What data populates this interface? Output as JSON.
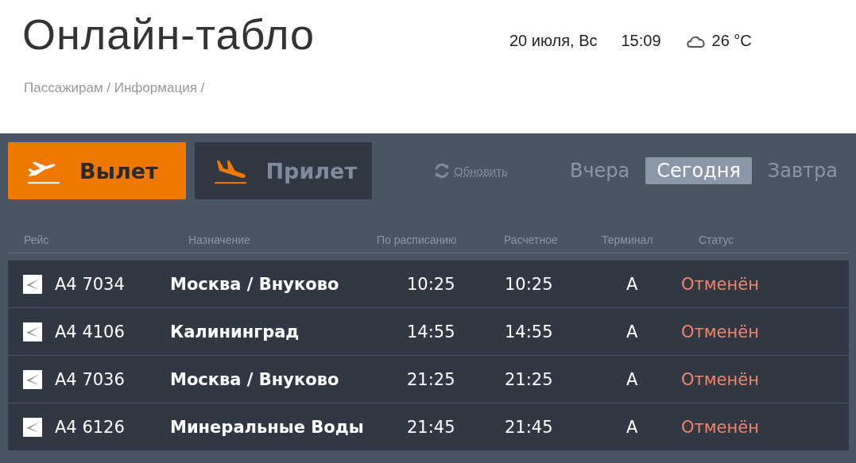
{
  "header": {
    "title": "Онлайн-табло",
    "date": "20 июля, Вс",
    "time": "15:09",
    "temperature": "26 °C",
    "breadcrumb": "Пассажирам / Информация /"
  },
  "direction_tabs": [
    {
      "label": "Вылет",
      "kind": "departure",
      "selected": true
    },
    {
      "label": "Прилет",
      "kind": "arrival",
      "selected": false
    }
  ],
  "refresh_link": "Обновить",
  "day_tabs": [
    {
      "label": "Вчера",
      "selected": false
    },
    {
      "label": "Сегодня",
      "selected": true
    },
    {
      "label": "Завтра",
      "selected": false
    }
  ],
  "table": {
    "columns": [
      "Рейс",
      "Назначение",
      "По расписанию",
      "Расчетное",
      "Терминал",
      "Статус"
    ],
    "rows": [
      {
        "flight": "А4 7034",
        "destination": "Москва / Внуково",
        "scheduled": "10:25",
        "estimated": "10:25",
        "terminal": "A",
        "status": "Отменён"
      },
      {
        "flight": "А4 4106",
        "destination": "Калининград",
        "scheduled": "14:55",
        "estimated": "14:55",
        "terminal": "A",
        "status": "Отменён"
      },
      {
        "flight": "А4 7036",
        "destination": "Москва / Внуково",
        "scheduled": "21:25",
        "estimated": "21:25",
        "terminal": "A",
        "status": "Отменён"
      },
      {
        "flight": "А4 6126",
        "destination": "Минеральные Воды",
        "scheduled": "21:45",
        "estimated": "21:45",
        "terminal": "A",
        "status": "Отменён"
      }
    ]
  }
}
